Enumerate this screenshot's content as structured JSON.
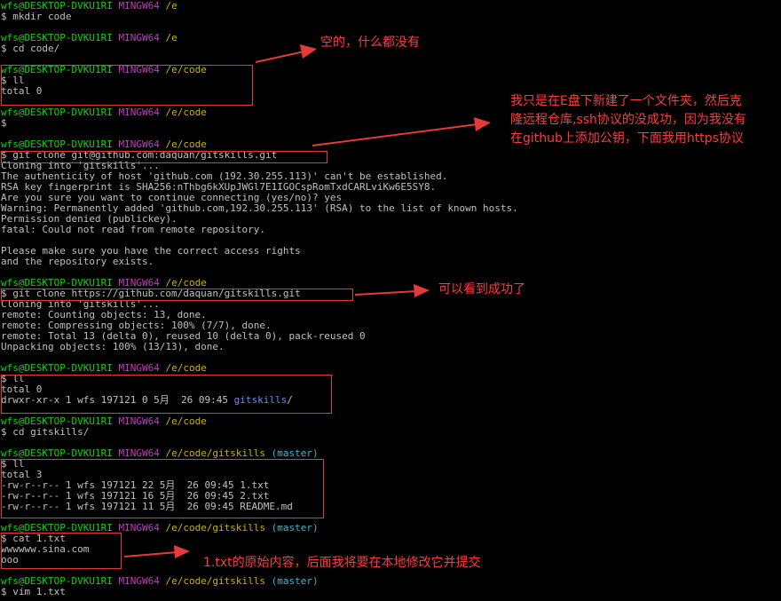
{
  "prompt": {
    "user": "wfs@DESKTOP-DVKU1RI",
    "host": "MINGW64"
  },
  "colors": {
    "user": "#17d00f",
    "host": "#bf3cbf",
    "path": "#c8b400",
    "branch": "#3fb7c7",
    "annotation": "#ff3b3b"
  },
  "lines": [
    {
      "type": "prompt",
      "path": "/e"
    },
    {
      "type": "text",
      "text": "$ mkdir code"
    },
    {
      "type": "blank"
    },
    {
      "type": "prompt",
      "path": "/e"
    },
    {
      "type": "text",
      "text": "$ cd code/"
    },
    {
      "type": "blank"
    },
    {
      "type": "prompt",
      "path": "/e/code"
    },
    {
      "type": "text",
      "text": "$ ll"
    },
    {
      "type": "text",
      "text": "total 0"
    },
    {
      "type": "blank"
    },
    {
      "type": "prompt",
      "path": "/e/code"
    },
    {
      "type": "text",
      "text": "$"
    },
    {
      "type": "blank"
    },
    {
      "type": "prompt",
      "path": "/e/code"
    },
    {
      "type": "text",
      "text": "$ git clone git@github.com:daquan/gitskills.git"
    },
    {
      "type": "text",
      "text": "Cloning into 'gitskills'..."
    },
    {
      "type": "text",
      "text": "The authenticity of host 'github.com (192.30.255.113)' can't be established."
    },
    {
      "type": "text",
      "text": "RSA key fingerprint is SHA256:nThbg6kXUpJWGl7E1IGOCspRomTxdCARLviKw6E5SY8."
    },
    {
      "type": "text",
      "text": "Are you sure you want to continue connecting (yes/no)? yes"
    },
    {
      "type": "text",
      "text": "Warning: Permanently added 'github.com,192.30.255.113' (RSA) to the list of known hosts."
    },
    {
      "type": "text",
      "text": "Permission denied (publickey)."
    },
    {
      "type": "text",
      "text": "fatal: Could not read from remote repository."
    },
    {
      "type": "blank"
    },
    {
      "type": "text",
      "text": "Please make sure you have the correct access rights"
    },
    {
      "type": "text",
      "text": "and the repository exists."
    },
    {
      "type": "blank"
    },
    {
      "type": "prompt",
      "path": "/e/code"
    },
    {
      "type": "text",
      "text": "$ git clone https://github.com/daquan/gitskills.git"
    },
    {
      "type": "text",
      "text": "Cloning into 'gitskills'..."
    },
    {
      "type": "text",
      "text": "remote: Counting objects: 13, done."
    },
    {
      "type": "text",
      "text": "remote: Compressing objects: 100% (7/7), done."
    },
    {
      "type": "text",
      "text": "remote: Total 13 (delta 0), reused 10 (delta 0), pack-reused 0"
    },
    {
      "type": "text",
      "text": "Unpacking objects: 100% (13/13), done."
    },
    {
      "type": "blank"
    },
    {
      "type": "prompt",
      "path": "/e/code"
    },
    {
      "type": "text",
      "text": "$ ll"
    },
    {
      "type": "text",
      "text": "total 0"
    },
    {
      "type": "dir",
      "text": "drwxr-xr-x 1 wfs 197121 0 5月  26 09:45 ",
      "name": "gitskills",
      "suffix": "/"
    },
    {
      "type": "blank"
    },
    {
      "type": "prompt",
      "path": "/e/code"
    },
    {
      "type": "text",
      "text": "$ cd gitskills/"
    },
    {
      "type": "blank"
    },
    {
      "type": "prompt",
      "path": "/e/code/gitskills",
      "branch": "(master)"
    },
    {
      "type": "text",
      "text": "$ ll"
    },
    {
      "type": "text",
      "text": "total 3"
    },
    {
      "type": "text",
      "text": "-rw-r--r-- 1 wfs 197121 22 5月  26 09:45 1.txt"
    },
    {
      "type": "text",
      "text": "-rw-r--r-- 1 wfs 197121 16 5月  26 09:45 2.txt"
    },
    {
      "type": "text",
      "text": "-rw-r--r-- 1 wfs 197121 11 5月  26 09:45 README.md"
    },
    {
      "type": "blank"
    },
    {
      "type": "prompt",
      "path": "/e/code/gitskills",
      "branch": "(master)"
    },
    {
      "type": "text",
      "text": "$ cat 1.txt"
    },
    {
      "type": "text",
      "text": "wwwwww.sina.com"
    },
    {
      "type": "text",
      "text": "ooo"
    },
    {
      "type": "blank"
    },
    {
      "type": "prompt",
      "path": "/e/code/gitskills",
      "branch": "(master)"
    },
    {
      "type": "text",
      "text": "$ vim 1.txt"
    }
  ],
  "annotations": {
    "empty_note": "空的，什么都没有",
    "ssh_note": "我只是在E盘下新建了一个文件夹，然后克\n隆远程仓库,ssh协议的没成功，因为我没有\n在github上添加公钥，下面我用https协议",
    "success_note": "可以看到成功了",
    "original_note": "1.txt的原始内容，后面我将要在本地修改它并提交"
  }
}
